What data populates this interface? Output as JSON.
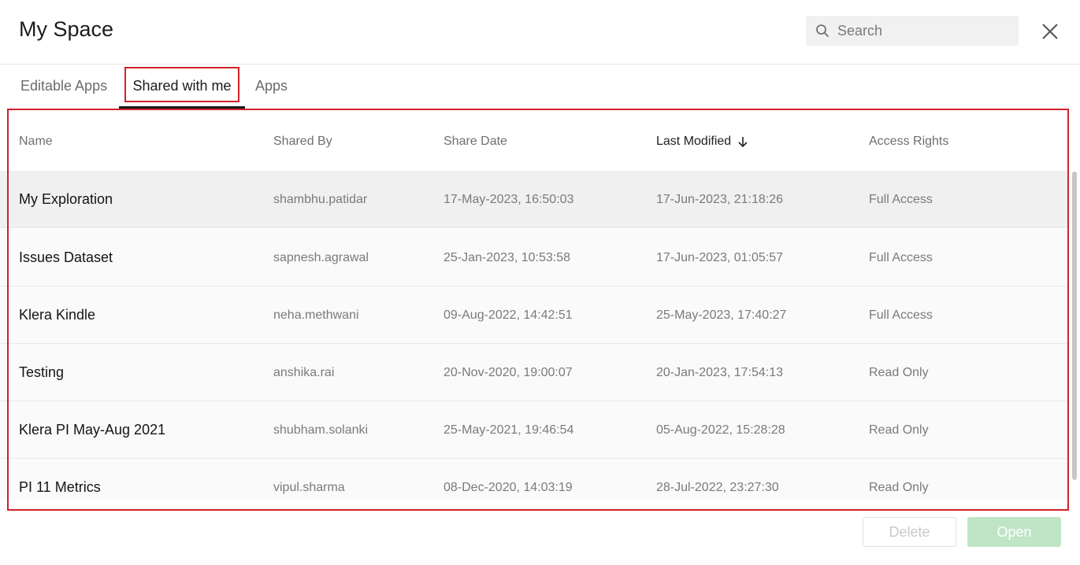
{
  "header": {
    "title": "My Space"
  },
  "search": {
    "placeholder": "Search",
    "icon": "search-icon"
  },
  "close": {
    "icon": "close-icon"
  },
  "tabs": [
    {
      "label": "Editable Apps",
      "active": false
    },
    {
      "label": "Shared with me",
      "active": true
    },
    {
      "label": "Apps",
      "active": false
    }
  ],
  "table": {
    "columns": [
      "Name",
      "Shared By",
      "Share Date",
      "Last Modified",
      "Access Rights"
    ],
    "sorted_column": "Last Modified",
    "sort_direction": "descending",
    "rows": [
      {
        "name": "My Exploration",
        "shared_by": "shambhu.patidar",
        "share_date": "17-May-2023, 16:50:03",
        "last_modified": "17-Jun-2023, 21:18:26",
        "access": "Full Access"
      },
      {
        "name": "Issues Dataset",
        "shared_by": "sapnesh.agrawal",
        "share_date": "25-Jan-2023, 10:53:58",
        "last_modified": "17-Jun-2023, 01:05:57",
        "access": "Full Access"
      },
      {
        "name": "Klera Kindle",
        "shared_by": "neha.methwani",
        "share_date": "09-Aug-2022, 14:42:51",
        "last_modified": "25-May-2023, 17:40:27",
        "access": "Full Access"
      },
      {
        "name": "Testing",
        "shared_by": "anshika.rai",
        "share_date": "20-Nov-2020, 19:00:07",
        "last_modified": "20-Jan-2023, 17:54:13",
        "access": "Read Only"
      },
      {
        "name": "Klera PI May-Aug 2021",
        "shared_by": "shubham.solanki",
        "share_date": "25-May-2021, 19:46:54",
        "last_modified": "05-Aug-2022, 15:28:28",
        "access": "Read Only"
      },
      {
        "name": "PI 11 Metrics",
        "shared_by": "vipul.sharma",
        "share_date": "08-Dec-2020, 14:03:19",
        "last_modified": "28-Jul-2022, 23:27:30",
        "access": "Read Only"
      }
    ]
  },
  "footer": {
    "delete_label": "Delete",
    "open_label": "Open"
  },
  "colors": {
    "highlight": "#d32029",
    "open_button": "#bfe5c6",
    "active_tab": "#1a1a1a"
  }
}
